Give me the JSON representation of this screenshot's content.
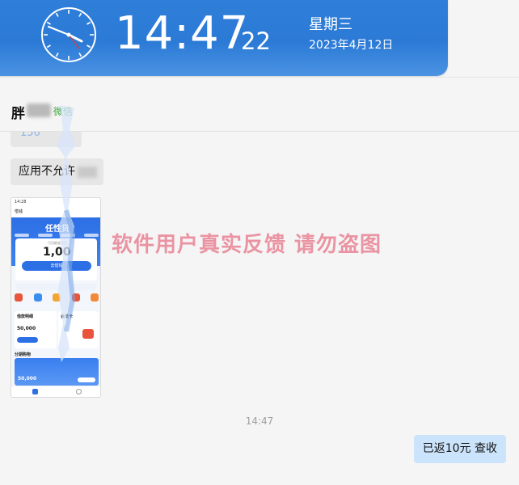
{
  "clock": {
    "time": "14:47",
    "seconds": "22",
    "weekday": "星期三",
    "date": "2023年4月12日"
  },
  "chat": {
    "contact_name": "胖",
    "contact_source": "微信",
    "messages": [
      {
        "id": "partial",
        "text": "156"
      },
      {
        "id": "m1",
        "text": "应用不允许"
      },
      {
        "id": "time",
        "text": "14:47"
      },
      {
        "id": "out1",
        "text": "已返10元 查收"
      }
    ],
    "image_watermark": "软件用户真实反馈  请勿盗图"
  },
  "screenshot_app": {
    "status_time": "14:28",
    "nav_title": "借钱",
    "hero_title": "任性贷",
    "amount_label": "可用额度(元)",
    "amount": "1,00",
    "button": "去借钱",
    "panel_left_title": "借款明细",
    "panel_left_num": "50,000",
    "panel_right_title": "会员卡",
    "section_title": "分期购物",
    "section_num": "50,000"
  },
  "colors": {
    "clock_bg": "#2b7ad6",
    "bubble_in": "#e6e6e6",
    "bubble_out": "#cce4fb",
    "source_green": "#3aa53a",
    "watermark": "#e66e82"
  }
}
